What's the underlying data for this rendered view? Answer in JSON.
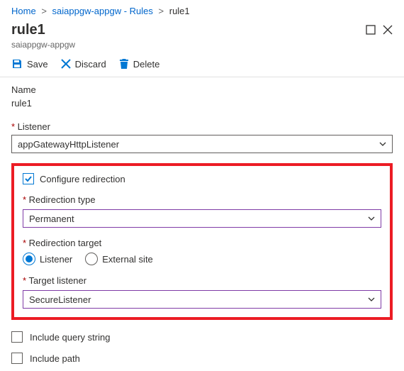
{
  "breadcrumb": {
    "home": "Home",
    "mid": "saiappgw-appgw - Rules",
    "current": "rule1"
  },
  "header": {
    "title": "rule1",
    "subtitle": "saiappgw-appgw"
  },
  "toolbar": {
    "save": "Save",
    "discard": "Discard",
    "delete": "Delete"
  },
  "form": {
    "name_label": "Name",
    "name_value": "rule1",
    "listener_label": "Listener",
    "listener_value": "appGatewayHttpListener",
    "configure_redirection_label": "Configure redirection",
    "redirection_type_label": "Redirection type",
    "redirection_type_value": "Permanent",
    "redirection_target_label": "Redirection target",
    "target_listener_option": "Listener",
    "target_external_option": "External site",
    "target_listener_label": "Target listener",
    "target_listener_value": "SecureListener",
    "include_query_string_label": "Include query string",
    "include_path_label": "Include path"
  }
}
